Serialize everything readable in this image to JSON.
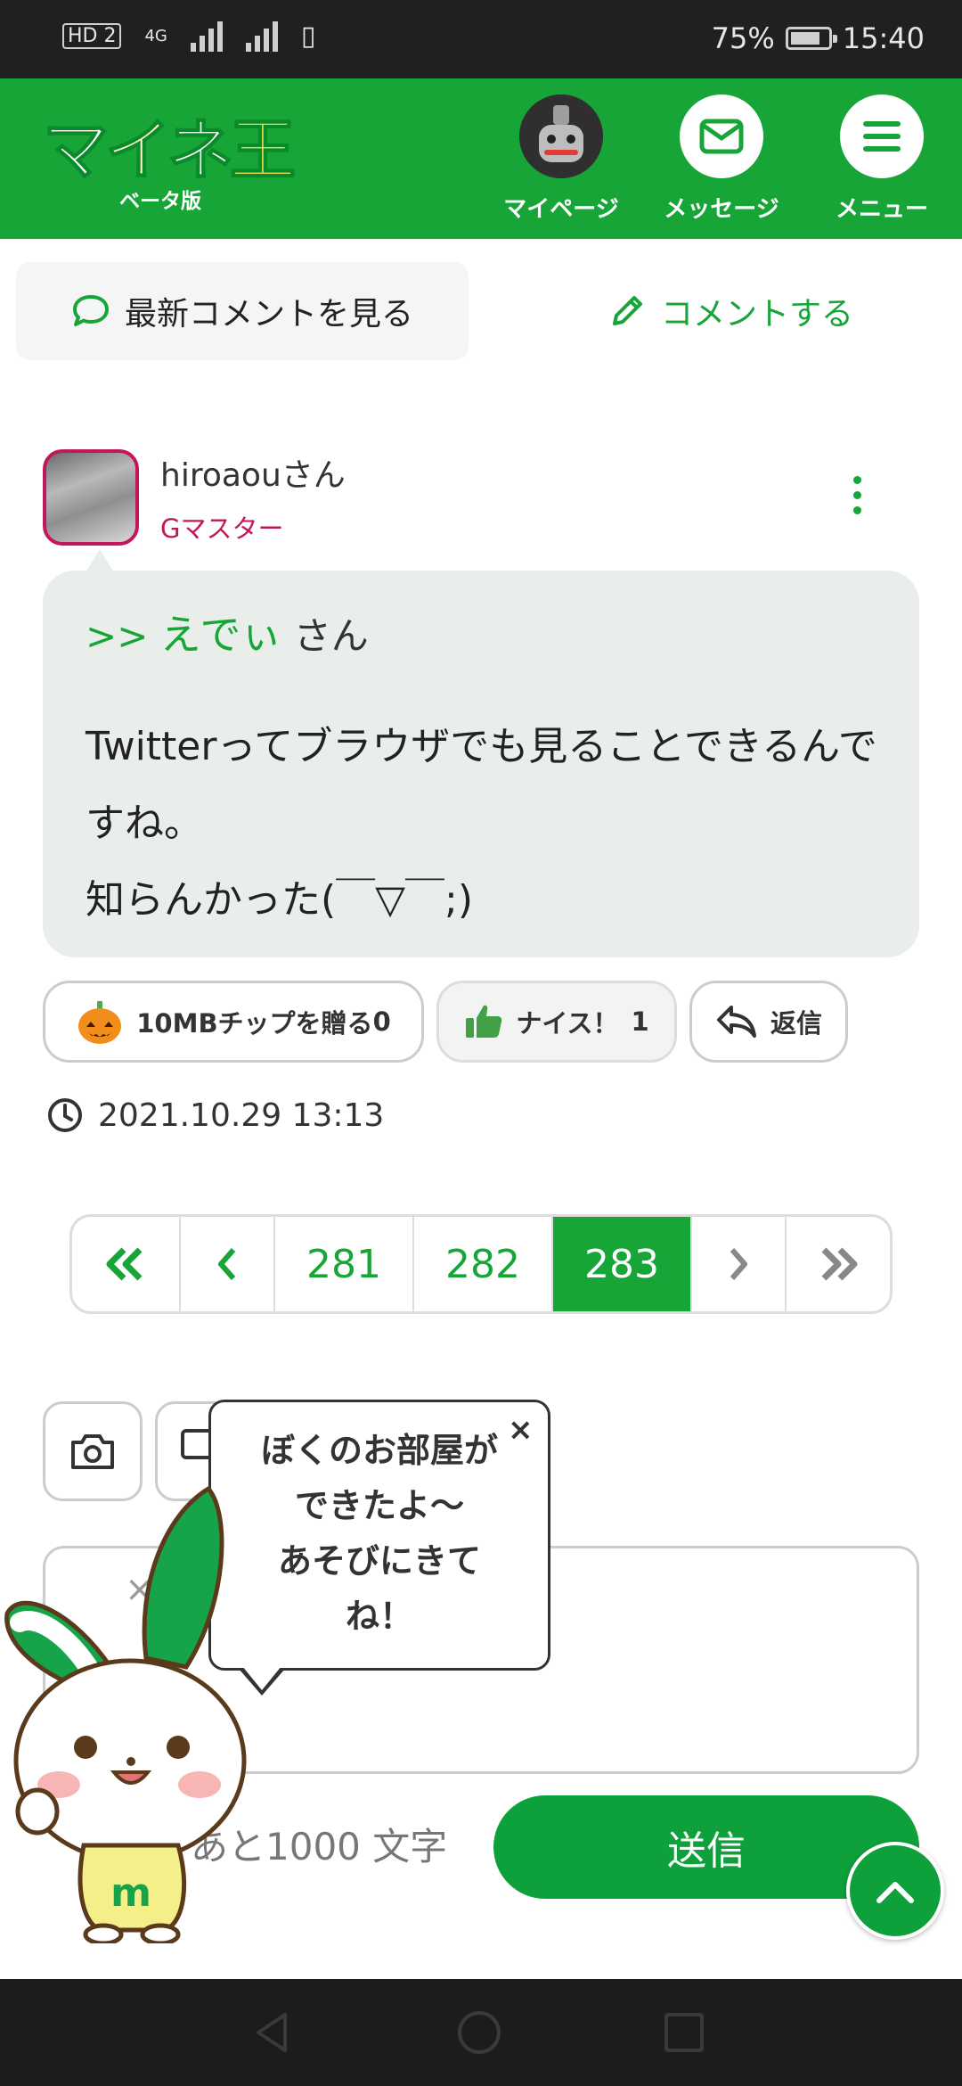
{
  "status": {
    "left_badges": [
      "HD 2",
      "4G"
    ],
    "battery": "75%",
    "time": "15:40"
  },
  "header": {
    "logo_chars": [
      "マ",
      "イ",
      "ネ",
      "王"
    ],
    "beta_label": "ベータ版",
    "nav": [
      {
        "label": "マイページ",
        "icon": "avatar-icon"
      },
      {
        "label": "メッセージ",
        "icon": "envelope-icon"
      },
      {
        "label": "メニュー",
        "icon": "hamburger-menu-icon"
      }
    ]
  },
  "tabs": {
    "latest_label": "最新コメントを見る",
    "comment_label": "コメントする"
  },
  "comment": {
    "username": "hiroaouさん",
    "rank": "Gマスター",
    "reply_prefix": ">>",
    "reply_name": "えでぃ",
    "reply_suffix": "さん",
    "body": "Twitterってブラウザでも見ることできるんですね。\n知らんかった(￣▽￣;)",
    "chip_label": "10MBチップを贈る",
    "chip_count": "0",
    "nice_label": "ナイス！",
    "nice_count": "1",
    "reply_label": "返信",
    "timestamp": "2021.10.29 13:13"
  },
  "pagination": {
    "first_label": "«",
    "prev_label": "‹",
    "pages": [
      "281",
      "282",
      "283"
    ],
    "current": "283",
    "next_label": "›",
    "last_label": "»"
  },
  "composer": {
    "remaining_text": "あと1000 文字",
    "send_label": "送信",
    "clear_label": "×"
  },
  "mascot": {
    "speech": "ぼくのお部屋が\nできたよ〜\nあそびにきて\nね！",
    "close_label": "×",
    "shirt_letter": "m"
  },
  "colors": {
    "brand_green": "#17a538",
    "rank_magenta": "#c2185b",
    "bubble_bg": "#e9eeeb"
  }
}
